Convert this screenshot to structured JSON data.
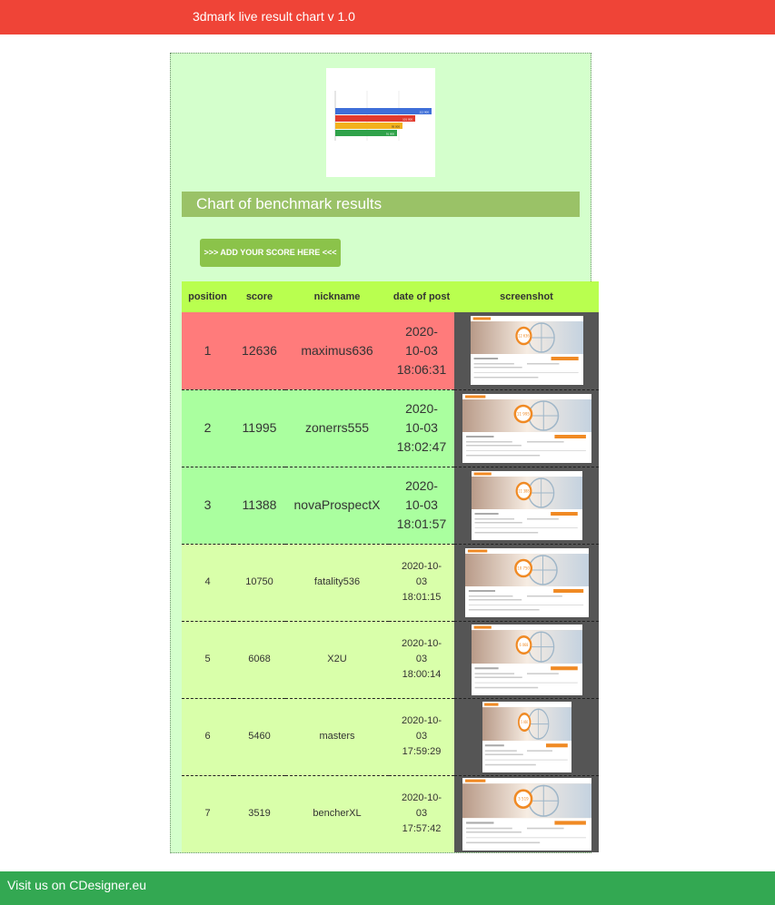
{
  "header": {
    "title": "3dmark live result chart v 1.0"
  },
  "thumbnail": {
    "bar_values": [
      "112 900",
      "101 000",
      "95 000",
      "91 000"
    ],
    "bar_colors": [
      "#3f6fd8",
      "#e23b2e",
      "#f2b21c",
      "#2fa24a"
    ]
  },
  "banner": {
    "title": "Chart of benchmark results"
  },
  "add_button": {
    "label": ">>> ADD YOUR SCORE HERE <<<"
  },
  "table": {
    "columns": [
      "position",
      "score",
      "nickname",
      "date of post",
      "screenshot"
    ],
    "rows": [
      {
        "position": "1",
        "score": "12636",
        "nickname": "maximus636",
        "date": "2020-\n10-03\n18:06:31",
        "color": "#ff7b7b",
        "badge": "12 636"
      },
      {
        "position": "2",
        "score": "11995",
        "nickname": "zonerrs555",
        "date": "2020-\n10-03\n18:02:47",
        "color": "#aaff9f",
        "badge": "11 995"
      },
      {
        "position": "3",
        "score": "11388",
        "nickname": "novaProspectX",
        "date": "2020-\n10-03\n18:01:57",
        "color": "#aaff9f",
        "badge": "11 388"
      },
      {
        "position": "4",
        "score": "10750",
        "nickname": "fatality536",
        "date": "2020-10-\n03\n18:01:15",
        "color": "#d9ffaa",
        "badge": "10 750"
      },
      {
        "position": "5",
        "score": "6068",
        "nickname": "X2U",
        "date": "2020-10-\n03\n18:00:14",
        "color": "#d9ffaa",
        "badge": "6 068"
      },
      {
        "position": "6",
        "score": "5460",
        "nickname": "masters",
        "date": "2020-10-\n03\n17:59:29",
        "color": "#d9ffaa",
        "badge": "5 460"
      },
      {
        "position": "7",
        "score": "3519",
        "nickname": "bencherXL",
        "date": "2020-10-\n03\n17:57:42",
        "color": "#d9ffaa",
        "badge": "3 519"
      }
    ]
  },
  "footer": {
    "text": "Visit us on CDesigner.eu"
  }
}
